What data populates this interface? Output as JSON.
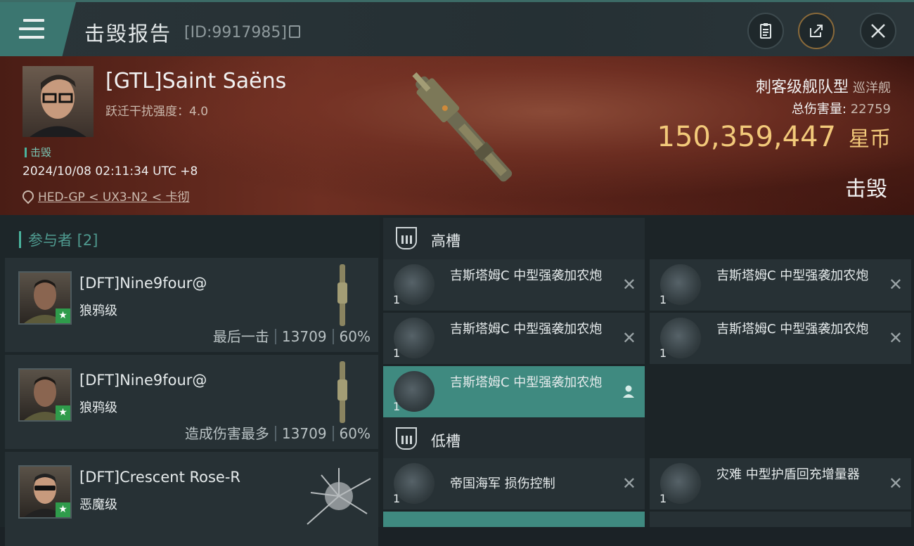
{
  "header": {
    "title": "击毁报告",
    "report_id": "[ID:9917985]",
    "menu_icon": "hamburger-icon",
    "buttons": [
      "clipboard-icon",
      "share-icon",
      "close-icon"
    ]
  },
  "victim": {
    "pilot_name": "[GTL]Saint Saëns",
    "warp_label": "跃迁干扰强度：4.0",
    "kill_tag": "击毁",
    "timestamp": "2024/10/08 02:11:34 UTC +8",
    "location": "HED-GP < UX3-N2 < 卡彻",
    "ship_class": "刺客级舰队型",
    "ship_type": "巡洋舰",
    "damage_label": "总伤害量:",
    "damage_value": "22759",
    "isk_value": "150,359,447",
    "isk_unit": "星币",
    "status": "击毁"
  },
  "participants": {
    "header": "参与者 [2]",
    "rows": [
      {
        "name": "[DFT]Nine9four@",
        "ship": "狼鸦级",
        "role": "最后一击",
        "damage": "13709",
        "percent": "60%"
      },
      {
        "name": "[DFT]Nine9four@",
        "ship": "狼鸦级",
        "role": "造成伤害最多",
        "damage": "13709",
        "percent": "60%"
      },
      {
        "name": "[DFT]Crescent Rose-R",
        "ship": "恶魔级",
        "role": "",
        "damage": "",
        "percent": ""
      }
    ]
  },
  "fitting": {
    "high_slot_label": "高槽",
    "low_slot_label": "低槽",
    "high_modules": [
      {
        "name": "吉斯塔姆C 中型强袭加农炮",
        "qty": "1"
      },
      {
        "name": "吉斯塔姆C 中型强袭加农炮",
        "qty": "1"
      },
      {
        "name": "吉斯塔姆C 中型强袭加农炮",
        "qty": "1"
      },
      {
        "name": "吉斯塔姆C 中型强袭加农炮",
        "qty": "1"
      },
      {
        "name": "吉斯塔姆C 中型强袭加农炮",
        "qty": "1"
      }
    ],
    "low_modules": [
      {
        "name": "帝国海军 损伤控制",
        "qty": "1"
      },
      {
        "name": "灾难 中型护盾回充增量器",
        "qty": "1"
      }
    ]
  },
  "colors": {
    "accent": "#3f8a80",
    "isk": "#f2c97a",
    "kill_tag": "#79c4b3"
  }
}
